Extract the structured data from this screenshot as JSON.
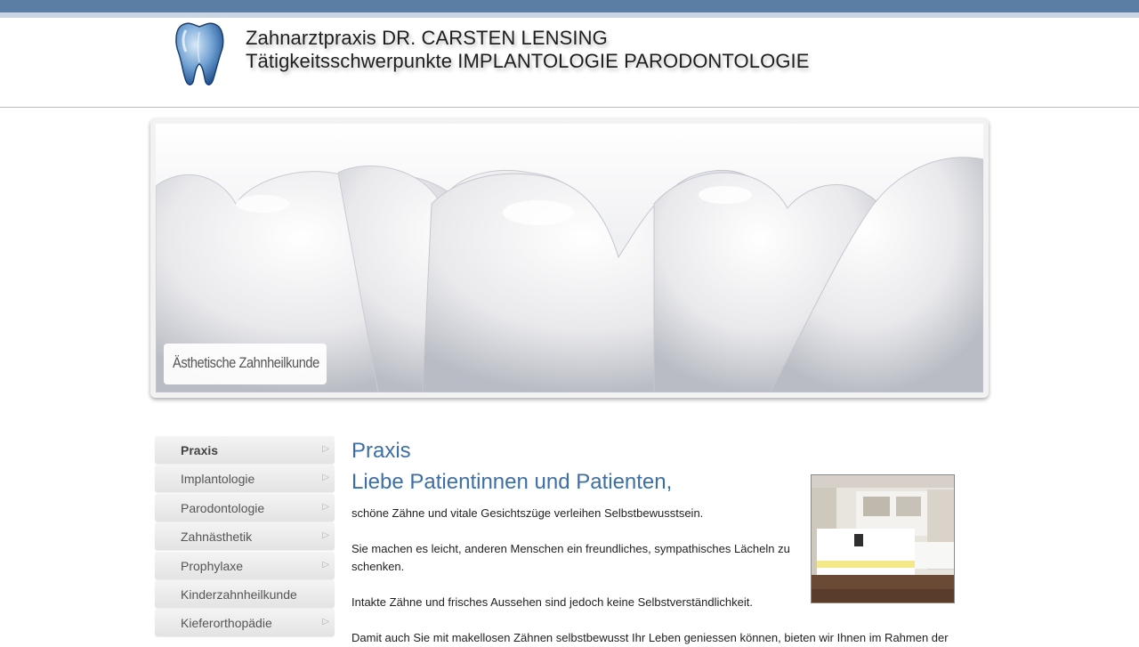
{
  "header": {
    "brand_line1": "Zahnarztpraxis DR. CARSTEN LENSING",
    "brand_line2": "Tätigkeitsschwerpunkte IMPLANTOLOGIE PARODONTOLOGIE",
    "logo_icon": "tooth-icon"
  },
  "hero": {
    "caption": "Ästhetische Zahnheilkunde"
  },
  "sidebar": {
    "items": [
      {
        "label": "Praxis",
        "active": true,
        "has_arrow": true
      },
      {
        "label": "Implantologie",
        "active": false,
        "has_arrow": true
      },
      {
        "label": "Parodontologie",
        "active": false,
        "has_arrow": true
      },
      {
        "label": "Zahnästhetik",
        "active": false,
        "has_arrow": true
      },
      {
        "label": "Prophylaxe",
        "active": false,
        "has_arrow": true
      },
      {
        "label": "Kinderzahnheilkunde",
        "active": false,
        "has_arrow": false
      },
      {
        "label": "Kieferorthopädie",
        "active": false,
        "has_arrow": true
      }
    ],
    "arrow_glyph": "▷"
  },
  "main": {
    "title": "Praxis",
    "subtitle": "Liebe Patientinnen und Patienten,",
    "paragraphs": [
      "schöne Zähne und vitale Gesichtszüge verleihen Selbstbewusstsein.",
      "Sie machen es leicht, anderen Menschen ein freundliches, sympathisches Lächeln zu schenken.",
      "Intakte Zähne und frisches Aussehen sind jedoch keine Selbstverständlichkeit.",
      "Damit auch Sie mit makellosen Zähnen selbstbewusst Ihr Leben geniessen können, bieten wir Ihnen im Rahmen der"
    ]
  },
  "colors": {
    "top_bar": "#5b7fa4",
    "heading_blue": "#3c6fa8",
    "text": "#1f1f1f"
  }
}
